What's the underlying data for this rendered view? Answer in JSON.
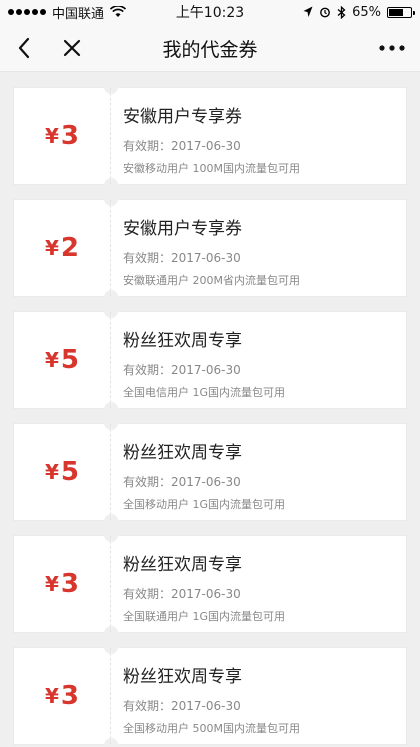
{
  "status_bar": {
    "carrier": "中国联通",
    "time": "上午10:23",
    "battery_percent": "65%",
    "battery_level": 0.65
  },
  "nav": {
    "title": "我的代金券"
  },
  "coupons": [
    {
      "currency": "¥",
      "amount": "3",
      "name": "安徽用户专享券",
      "validity": "有效期：2017-06-30",
      "desc": "安徽移动用户 100M国内流量包可用"
    },
    {
      "currency": "¥",
      "amount": "2",
      "name": "安徽用户专享券",
      "validity": "有效期：2017-06-30",
      "desc": "安徽联通用户 200M省内流量包可用"
    },
    {
      "currency": "¥",
      "amount": "5",
      "name": "粉丝狂欢周专享",
      "validity": "有效期：2017-06-30",
      "desc": "全国电信用户 1G国内流量包可用"
    },
    {
      "currency": "¥",
      "amount": "5",
      "name": "粉丝狂欢周专享",
      "validity": "有效期：2017-06-30",
      "desc": "全国移动用户 1G国内流量包可用"
    },
    {
      "currency": "¥",
      "amount": "3",
      "name": "粉丝狂欢周专享",
      "validity": "有效期：2017-06-30",
      "desc": "全国联通用户 1G国内流量包可用"
    },
    {
      "currency": "¥",
      "amount": "3",
      "name": "粉丝狂欢周专享",
      "validity": "有效期：2017-06-30",
      "desc": "全国移动用户 500M国内流量包可用"
    }
  ],
  "icons": {
    "back": "chevron-left-icon",
    "close": "close-icon",
    "more": "more-icon",
    "wifi": "wifi-icon",
    "location": "location-icon",
    "alarm": "alarm-icon",
    "bluetooth": "bluetooth-icon",
    "battery": "battery-icon"
  },
  "colors": {
    "accent": "#d8352c",
    "background": "#efefef"
  }
}
